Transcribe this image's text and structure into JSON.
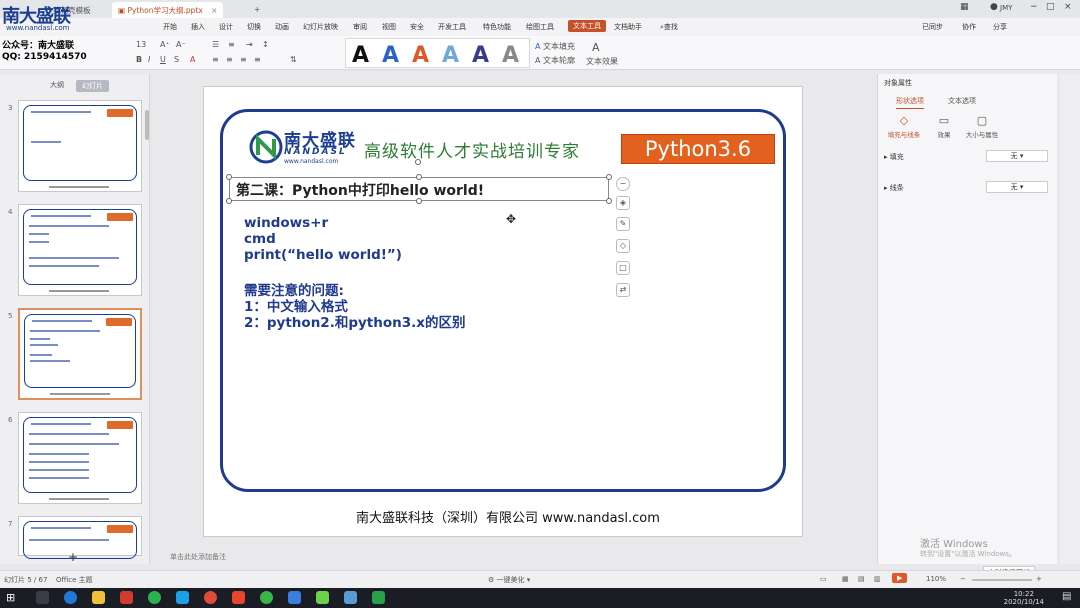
{
  "watermark": {
    "title": "南大盛联",
    "url": "www.nandasl.com",
    "line1": "公众号：南大盛联",
    "line2": "QQ: 2159414570"
  },
  "titlebar": {
    "tabs": [
      {
        "label": "Python学习大纲.pptx",
        "active": true
      }
    ]
  },
  "ribbon": {
    "tabs": [
      "开始",
      "插入",
      "设计",
      "切换",
      "动画",
      "幻灯片放映",
      "审阅",
      "视图",
      "安全",
      "开发工具",
      "特色功能",
      "绘图工具",
      "文本工具",
      "文档助手"
    ],
    "active_tab": "文本工具",
    "search": "查找",
    "font_size": "13",
    "text_fill": "文本填充",
    "text_outline": "文本轮廓",
    "text_effect": "文本效果",
    "right_items": [
      "已同步",
      "协作",
      "分享"
    ],
    "user": "JMY",
    "style_colors": [
      "#111111",
      "#2b63c7",
      "#e2572a",
      "#6fa8dc",
      "#3a3a8c",
      "#888888"
    ]
  },
  "leftpane": {
    "tabs": [
      "大纲",
      "幻灯片"
    ],
    "active_tab": "幻灯片",
    "slides": [
      {
        "num": "3",
        "selected": false
      },
      {
        "num": "4",
        "selected": false
      },
      {
        "num": "5",
        "selected": true
      },
      {
        "num": "6",
        "selected": false
      },
      {
        "num": "7",
        "selected": false
      }
    ]
  },
  "slide": {
    "logo_cn": "南大盛联",
    "logo_en": "NANDASL",
    "logo_url": "www.nandasl.com",
    "slogan": "高级软件人才实战培训专家",
    "badge": "Python3.6",
    "title": "第二课：Python中打印hello world!",
    "lines": [
      "windows+r",
      "cmd",
      "print(“hello world!”)"
    ],
    "notes_heading": "需要注意的问题:",
    "notes": [
      "1：中文输入格式",
      "2：python2.和python3.x的区别"
    ],
    "footer": "南大盛联科技（深圳）有限公司 www.nandasl.com",
    "colors": {
      "frame": "#1f3a8f",
      "badge": "#e2611f",
      "slogan": "#2e7d32"
    }
  },
  "rightpane": {
    "title": "对象属性",
    "tabs": [
      "形状选项",
      "文本选项"
    ],
    "active_tab": "形状选项",
    "sub_tabs": [
      "填充与线条",
      "效果",
      "大小与属性"
    ],
    "rows": [
      {
        "label": "填充",
        "value": "无"
      },
      {
        "label": "线条",
        "value": "无"
      }
    ]
  },
  "notes_placeholder": "单击此处添加备注",
  "activate": {
    "line1": "激活 Windows",
    "line2": "转到\"设置\"以激活 Windows。"
  },
  "update_button": "实时资讯更新",
  "statusbar": {
    "slide_pos": "幻灯片 5 / 67",
    "theme": "Office 主题",
    "beautify": "一键美化",
    "zoom": "110%"
  },
  "taskbar": {
    "time": "10:22",
    "date": "2020/10/14"
  }
}
